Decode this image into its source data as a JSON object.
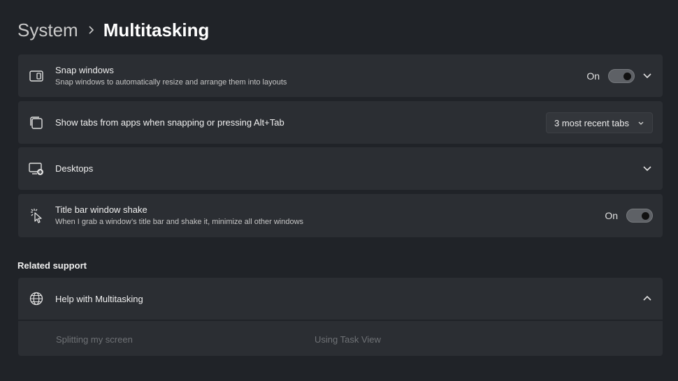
{
  "breadcrumb": {
    "parent": "System",
    "current": "Multitasking"
  },
  "snap_windows": {
    "title": "Snap windows",
    "description": "Snap windows to automatically resize and arrange them into layouts",
    "toggle_state": "On",
    "icon": "snap-layout-icon"
  },
  "show_tabs": {
    "title": "Show tabs from apps when snapping or pressing Alt+Tab",
    "dropdown_value": "3 most recent tabs",
    "icon": "tabs-icon"
  },
  "desktops": {
    "title": "Desktops",
    "icon": "desktops-icon"
  },
  "title_bar_shake": {
    "title": "Title bar window shake",
    "description": "When I grab a window’s title bar and shake it, minimize all other windows",
    "toggle_state": "On",
    "icon": "shake-cursor-icon"
  },
  "related_support": {
    "label": "Related support",
    "help": {
      "title": "Help with Multitasking",
      "icon": "globe-icon",
      "links": [
        "Splitting my screen",
        "Using Task View"
      ]
    }
  },
  "colors": {
    "background": "#202328",
    "card": "#2b2e33",
    "toggle_on": "#5e6166"
  }
}
